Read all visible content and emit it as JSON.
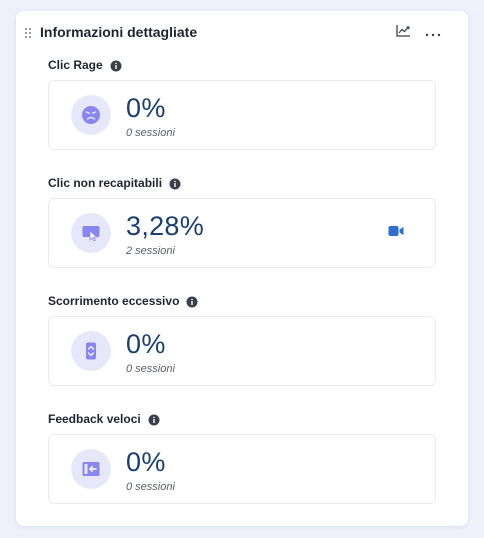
{
  "panel": {
    "title": "Informazioni dettagliate",
    "actions": {
      "chart_icon": "trend-chart-icon",
      "more_label": "···"
    }
  },
  "sections": [
    {
      "label": "Clic Rage",
      "value": "0%",
      "sessions": "0 sessioni",
      "icon": "angry-face-icon",
      "has_video": false
    },
    {
      "label": "Clic non recapitabili",
      "value": "3,28%",
      "sessions": "2 sessioni",
      "icon": "dead-click-icon",
      "has_video": true
    },
    {
      "label": "Scorrimento eccessivo",
      "value": "0%",
      "sessions": "0 sessioni",
      "icon": "scroll-icon",
      "has_video": false
    },
    {
      "label": "Feedback veloci",
      "value": "0%",
      "sessions": "0 sessioni",
      "icon": "feedback-icon",
      "has_video": false
    }
  ],
  "colors": {
    "accent": "#1b3f72",
    "icon_bg": "#e6e8fa",
    "icon_fg": "#8a86f0",
    "video": "#2c6fd1"
  }
}
